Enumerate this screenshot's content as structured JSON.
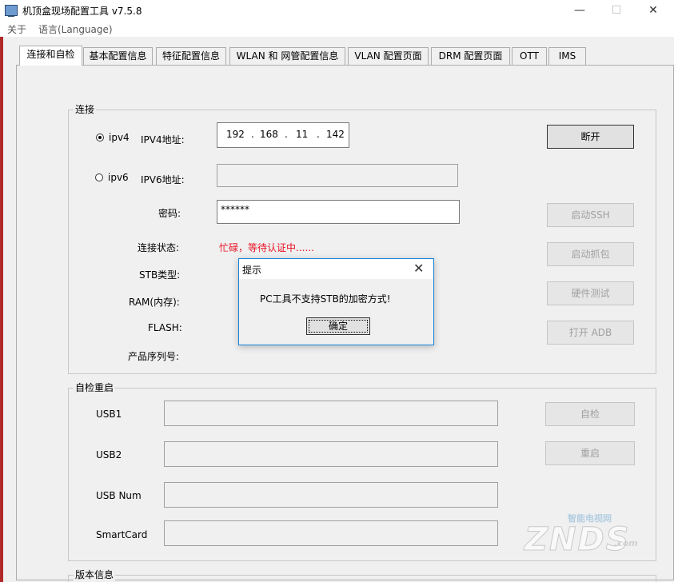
{
  "window": {
    "title": "机顶盒现场配置工具 v7.5.8",
    "minimize_glyph": "—",
    "maximize_glyph": "☐",
    "close_glyph": "✕"
  },
  "menu": {
    "items": [
      "关于",
      "语言(Language)"
    ]
  },
  "tabs": [
    {
      "label": "连接和自检",
      "active": true
    },
    {
      "label": "基本配置信息"
    },
    {
      "label": "特征配置信息"
    },
    {
      "label": "WLAN 和 网管配置信息"
    },
    {
      "label": "VLAN 配置页面"
    },
    {
      "label": "DRM 配置页面"
    },
    {
      "label": "OTT"
    },
    {
      "label": "IMS"
    }
  ],
  "connect": {
    "group_title": "连接",
    "ipv4": {
      "label": "ipv4",
      "checked": true,
      "addr_label": "IPV4地址:",
      "octets": [
        "192",
        "168",
        "11",
        "142"
      ]
    },
    "ipv6": {
      "label": "ipv6",
      "checked": false,
      "addr_label": "IPV6地址:",
      "value": ""
    },
    "password": {
      "label": "密码:",
      "value": "******"
    },
    "status": {
      "label": "连接状态:",
      "value": "忙碌，等待认证中......"
    },
    "stb_type": {
      "label": "STB类型:"
    },
    "ram": {
      "label": "RAM(内存):"
    },
    "flash": {
      "label": "FLASH:"
    },
    "serial": {
      "label": "产品序列号:"
    },
    "buttons": {
      "disconnect": "断开",
      "ssh": "启动SSH",
      "capture": "启动抓包",
      "hw_test": "硬件测试",
      "adb": "打开 ADB"
    }
  },
  "selfcheck": {
    "group_title": "自检重启",
    "usb1": "USB1",
    "usb2": "USB2",
    "usb_num": "USB Num",
    "smartcard": "SmartCard",
    "buttons": {
      "selfcheck": "自检",
      "reboot": "重启"
    }
  },
  "version": {
    "group_title": "版本信息"
  },
  "dialog": {
    "title": "提示",
    "close_glyph": "✕",
    "message": "PC工具不支持STB的加密方式!",
    "ok": "确定"
  },
  "watermark": {
    "brand": "ZNDS",
    "slogan": "智能电视网",
    "suffix": ".com"
  },
  "colors": {
    "status_red": "#e81123",
    "dialog_border": "#1883d7"
  }
}
